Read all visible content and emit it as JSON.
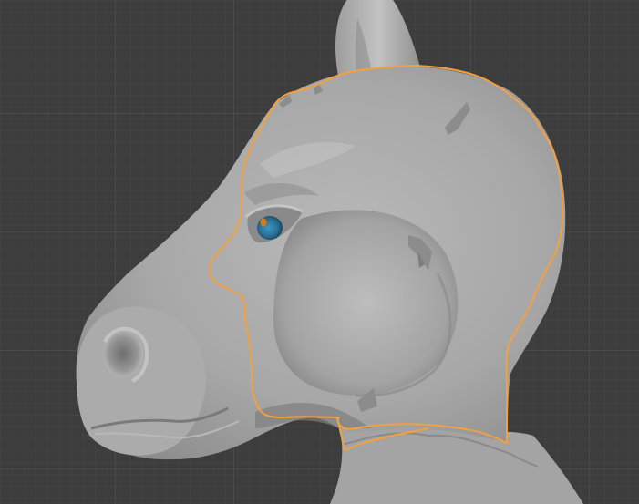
{
  "viewport": {
    "name": "3d-viewport",
    "background_color": "#3d3d3d",
    "grid_minor_color": "#464646",
    "grid_major_color": "#525252",
    "selection_outline_color": "#f2a040",
    "mesh_color": "#a6a6a6",
    "selection_mask_color": "#8c8c8c",
    "eye_iris_color": "#2f7fa8",
    "eye_highlight_color": "#d87a18"
  },
  "scene": {
    "object": "horse-head-sculpt",
    "selected": true,
    "view": "side"
  }
}
